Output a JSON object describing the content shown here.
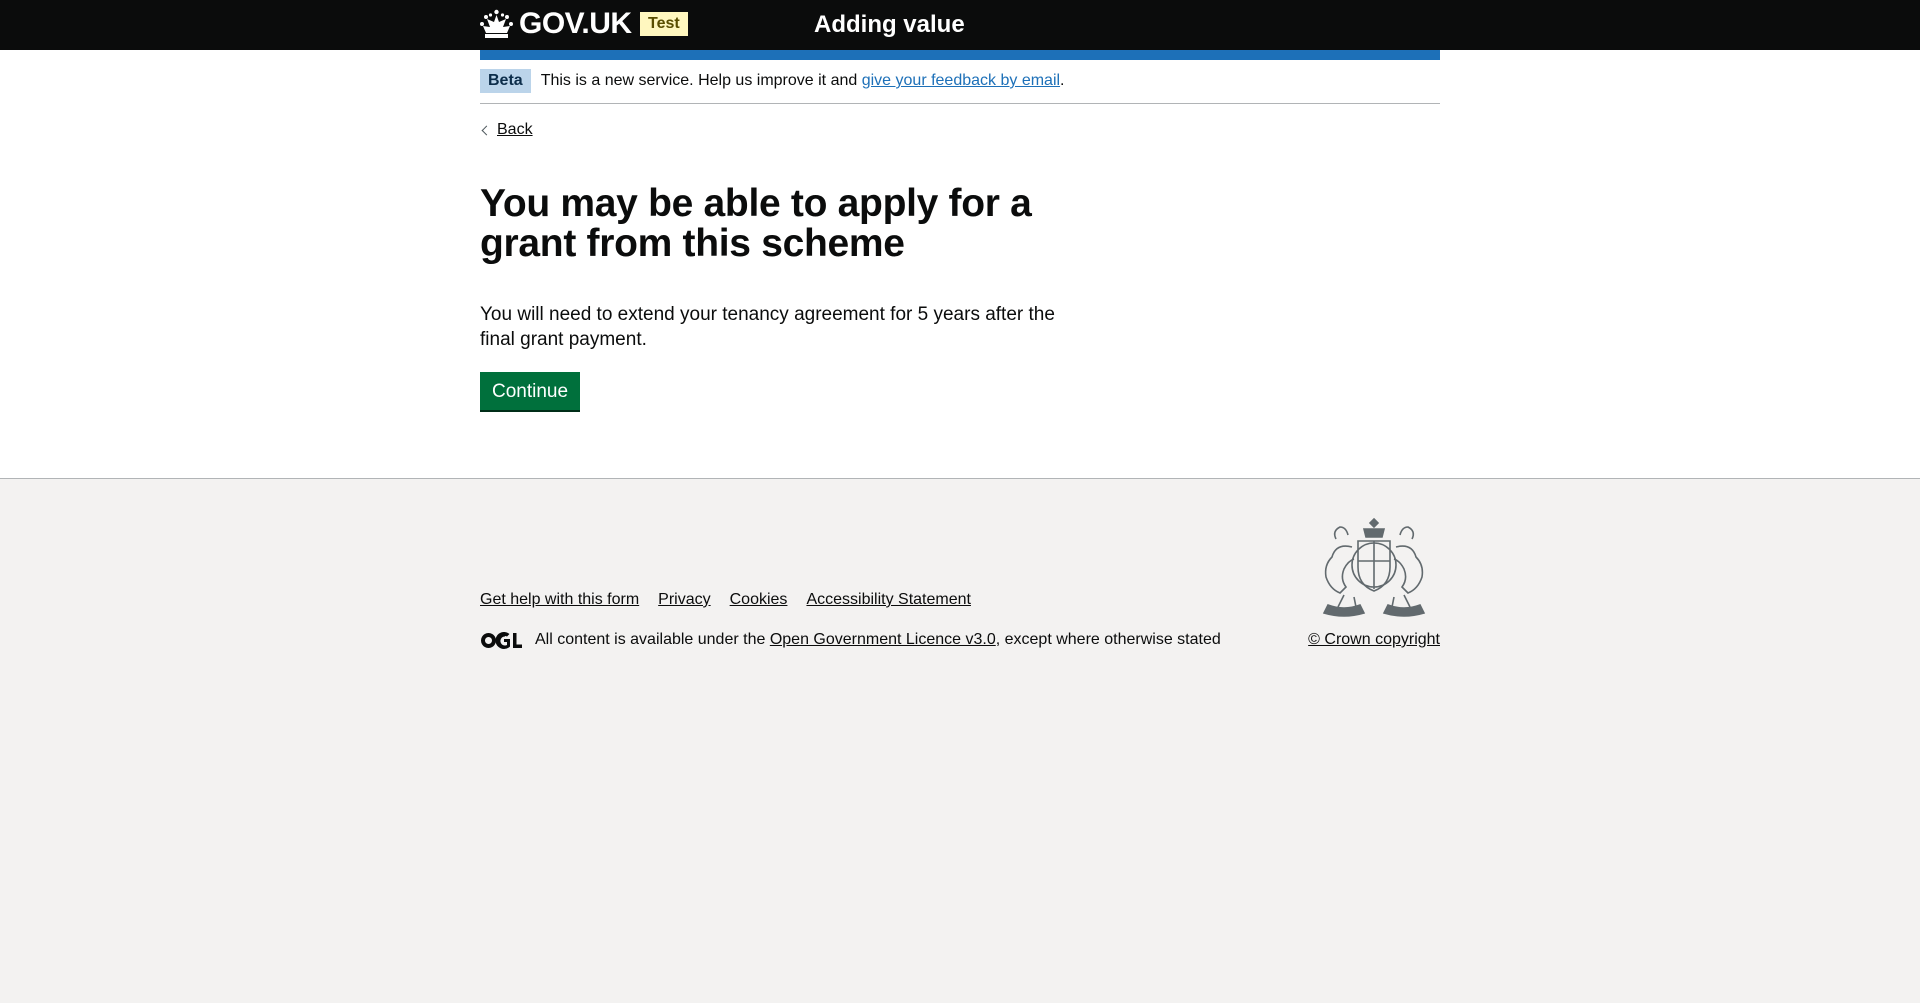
{
  "header": {
    "logo_text": "GOV.UK",
    "env_tag": "Test",
    "service_name": "Adding value"
  },
  "phase_banner": {
    "tag": "Beta",
    "text": "This is a new service. Help us improve it and",
    "link_text": "give your feedback by email",
    "suffix": "."
  },
  "back_link": "Back",
  "main": {
    "heading": "You may be able to apply for a grant from this scheme",
    "body": "You will need to extend your tenancy agreement for 5 years after the final grant payment.",
    "continue_label": "Continue"
  },
  "footer": {
    "links": [
      "Get help with this form",
      "Privacy",
      "Cookies",
      "Accessibility Statement"
    ],
    "licence_prefix": "All content is available under the",
    "licence_link": "Open Government Licence v3.0",
    "licence_suffix": ", except where otherwise stated",
    "copyright": "© Crown copyright"
  },
  "colors": {
    "header_bg": "#0b0c0c",
    "brand_blue": "#1d70b8",
    "button_green": "#00703c",
    "footer_bg": "#f3f2f1"
  }
}
